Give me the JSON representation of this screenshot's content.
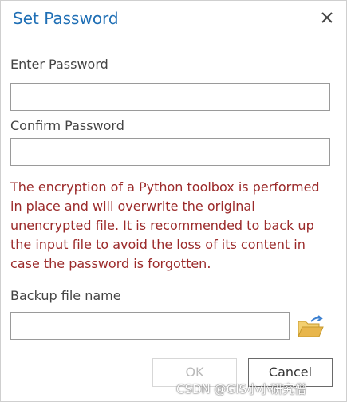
{
  "dialog": {
    "title": "Set Password",
    "close_icon": "close-icon"
  },
  "fields": {
    "password_label": "Enter Password",
    "password_value": "",
    "confirm_label": "Confirm Password",
    "confirm_value": "",
    "backup_label": "Backup file name",
    "backup_value": ""
  },
  "warning_text": "The encryption of a Python toolbox is performed in place and will overwrite the original unencrypted file. It is recommended to back up the input file to avoid the loss of its content in case the password is forgotten.",
  "buttons": {
    "ok_label": "OK",
    "ok_enabled": false,
    "cancel_label": "Cancel",
    "browse_icon": "open-folder-icon"
  },
  "colors": {
    "title": "#1f6fb5",
    "warning": "#9b2a2a",
    "folder": "#e8b64c",
    "arrow": "#3a7fd0"
  },
  "watermark": "CSDN @GIS小小研究僧"
}
